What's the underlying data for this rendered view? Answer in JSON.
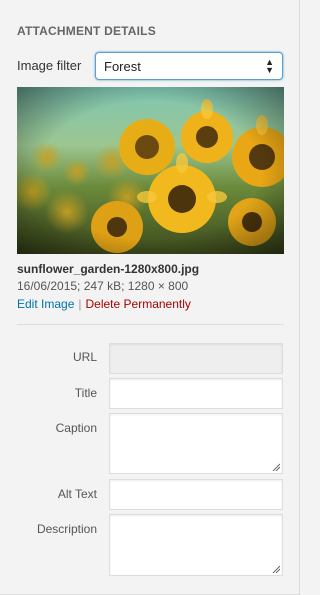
{
  "attachment": {
    "heading": "Attachment Details",
    "filter_label": "Image filter",
    "filter_value": "Forest",
    "image_description": "Sunflowers photo with forest filter",
    "file_name": "sunflower_garden-1280x800.jpg",
    "date": "16/06/2015;",
    "size": "247 kB;",
    "dimensions": "1280 × 800",
    "edit_label": "Edit Image",
    "separator": "|",
    "delete_label": "Delete Permanently"
  },
  "fields": {
    "url_label": "URL",
    "url_value": "",
    "title_label": "Title",
    "title_value": "",
    "caption_label": "Caption",
    "caption_value": "",
    "alt_label": "Alt Text",
    "alt_value": "",
    "description_label": "Description",
    "description_value": ""
  },
  "colors": {
    "link": "#0073aa",
    "delete": "#aa0000",
    "focus": "#5b9dd9"
  }
}
